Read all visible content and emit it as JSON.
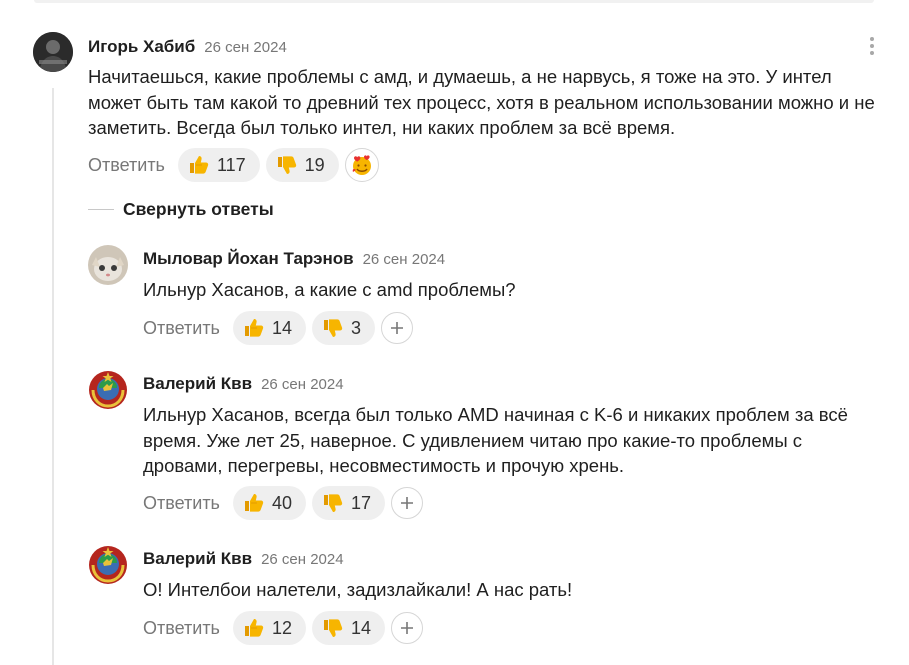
{
  "main_comment": {
    "author": "Игорь Хабиб",
    "date": "26 сен 2024",
    "text": "Начитаешься, какие проблемы с амд, и думаешь, а не нарвусь, я тоже на это. У интел может быть там какой то древний тех процесс, хотя в реальном использовании можно и не заметить. Всегда был только интел, ни каких проблем за всё время.",
    "reply_label": "Ответить",
    "likes": "117",
    "dislikes": "19"
  },
  "collapse_label": "Свернуть ответы",
  "replies": [
    {
      "author": "Мыловар Йохан Тарэнов",
      "date": "26 сен 2024",
      "text": "Ильнур Хасанов, а какие с amd проблемы?",
      "reply_label": "Ответить",
      "likes": "14",
      "dislikes": "3"
    },
    {
      "author": "Валерий Квв",
      "date": "26 сен 2024",
      "text": "Ильнур Хасанов, всегда был только AMD начиная с K-6 и никаких проблем за всё время. Уже лет 25, наверное. С удивлением читаю про какие-то проблемы с дровами, перегревы, несовместимость и прочую хрень.",
      "reply_label": "Ответить",
      "likes": "40",
      "dislikes": "17"
    },
    {
      "author": "Валерий Квв",
      "date": "26 сен 2024",
      "text": "О! Интелбои налетели, задизлайкали! А нас рать!",
      "reply_label": "Ответить",
      "likes": "12",
      "dislikes": "14"
    }
  ],
  "icons": {
    "like": "thumbs-up-icon",
    "dislike": "thumbs-down-icon",
    "add_reaction": "plus-icon",
    "more": "more-vertical-icon",
    "emoji": "heart-face-emoji-icon"
  },
  "colors": {
    "thumb": "#f5b800",
    "reaction_bg": "#efefef",
    "muted_text": "#777777"
  }
}
